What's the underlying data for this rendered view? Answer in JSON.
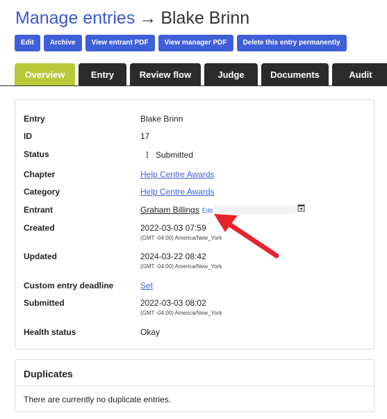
{
  "header": {
    "crumb": "Manage entries",
    "arrow": "→",
    "title": "Blake Brinn"
  },
  "actions": [
    "Edit",
    "Archive",
    "View entrant PDF",
    "View manager PDF",
    "Delete this entry permanently"
  ],
  "tabs": [
    {
      "label": "Overview",
      "active": true
    },
    {
      "label": "Entry",
      "active": false
    },
    {
      "label": "Review flow",
      "active": false
    },
    {
      "label": "Judge",
      "active": false
    },
    {
      "label": "Documents",
      "active": false
    },
    {
      "label": "Audit",
      "active": false
    }
  ],
  "details": {
    "entry": {
      "label": "Entry",
      "value": "Blake Brinn"
    },
    "id": {
      "label": "ID",
      "value": "17"
    },
    "status": {
      "label": "Status",
      "value": "Submitted",
      "menu_glyph": "⋮"
    },
    "chapter": {
      "label": "Chapter",
      "value": "Help Centre Awards"
    },
    "category": {
      "label": "Category",
      "value": "Help Centre Awards"
    },
    "entrant": {
      "label": "Entrant",
      "value": "Graham Billings",
      "edit": "Edit"
    },
    "created": {
      "label": "Created",
      "date": "2022-03-03 07:59",
      "tz": "(GMT -04:00) America/New_York"
    },
    "updated": {
      "label": "Updated",
      "date": "2024-03-22 08:42",
      "tz": "(GMT -04:00) America/New_York"
    },
    "deadline": {
      "label": "Custom entry deadline",
      "value": "Set"
    },
    "submitted": {
      "label": "Submitted",
      "date": "2022-03-03 08:02",
      "tz": "(GMT -04:00) America/New_York"
    },
    "health": {
      "label": "Health status",
      "value": "Okay"
    }
  },
  "duplicates": {
    "title": "Duplicates",
    "message": "There are currently no duplicate entries."
  },
  "colors": {
    "accent": "#3f5fd9",
    "active_tab": "#b9c93a",
    "tab": "#2b2b2b",
    "callout": "#e8222b"
  }
}
